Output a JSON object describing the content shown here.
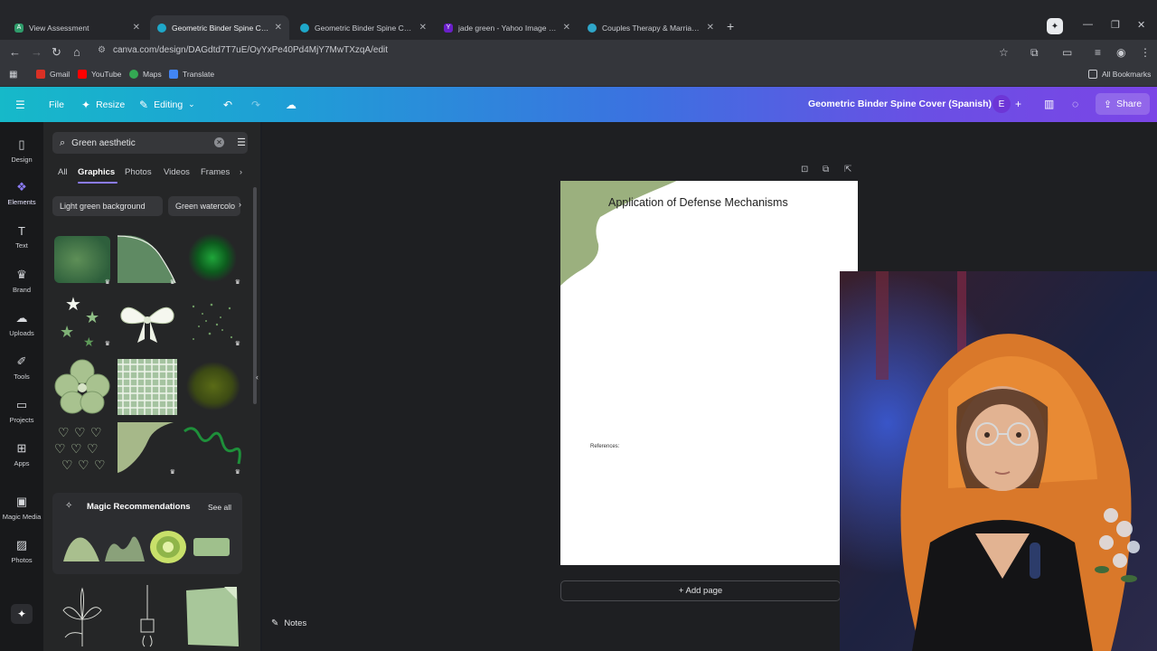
{
  "browser": {
    "tabs": [
      {
        "title": "View Assessment",
        "active": false,
        "favicon_color": "#2f9c6b"
      },
      {
        "title": "Geometric Binder Spine Cover",
        "active": true,
        "favicon_color": "#1ea7c9"
      },
      {
        "title": "Geometric Binder Spine Cover",
        "active": false,
        "favicon_color": "#1ea7c9"
      },
      {
        "title": "jade green - Yahoo Image Sear",
        "active": false,
        "favicon_color": "#6a1fc9"
      },
      {
        "title": "Couples Therapy & Marriage C",
        "active": false,
        "favicon_color": "#2fa6c9"
      }
    ],
    "url": "canva.com/design/DAGdtd7T7uE/OyYxPe40Pd4MjY7MwTXzqA/edit",
    "bookmarks": [
      {
        "label": "Gmail",
        "color": "#d93025"
      },
      {
        "label": "YouTube",
        "color": "#ff0000"
      },
      {
        "label": "Maps",
        "color": "#34a853"
      },
      {
        "label": "Translate",
        "color": "#4285f4"
      }
    ],
    "all_bookmarks": "All Bookmarks"
  },
  "topbar": {
    "file": "File",
    "resize": "Resize",
    "editing": "Editing",
    "design_title": "Geometric Binder Spine Cover (Spanish)",
    "avatar_letter": "E",
    "share": "Share"
  },
  "rail": [
    {
      "label": "Design",
      "icon": "design-icon"
    },
    {
      "label": "Elements",
      "icon": "elements-icon",
      "active": true
    },
    {
      "label": "Text",
      "icon": "text-icon"
    },
    {
      "label": "Brand",
      "icon": "brand-icon"
    },
    {
      "label": "Uploads",
      "icon": "uploads-icon"
    },
    {
      "label": "Tools",
      "icon": "tools-icon"
    },
    {
      "label": "Projects",
      "icon": "projects-icon"
    },
    {
      "label": "Apps",
      "icon": "apps-icon"
    },
    {
      "label": "Magic Media",
      "icon": "magic-media-icon"
    },
    {
      "label": "Photos",
      "icon": "photos-icon"
    }
  ],
  "panel": {
    "search_value": "Green aesthetic",
    "tabs": [
      "All",
      "Graphics",
      "Photos",
      "Videos",
      "Frames"
    ],
    "active_tab": "Graphics",
    "chips": [
      "Light green background",
      "Green watercolo"
    ],
    "magic_title": "Magic Recommendations",
    "see_all": "See all"
  },
  "canvas": {
    "page_title": "Application of Defense Mechanisms",
    "references": "References:",
    "add_page": "+ Add page",
    "notes": "Notes"
  },
  "colors": {
    "sage": "#9bb07e",
    "accent_purple": "#8b7cf6"
  }
}
